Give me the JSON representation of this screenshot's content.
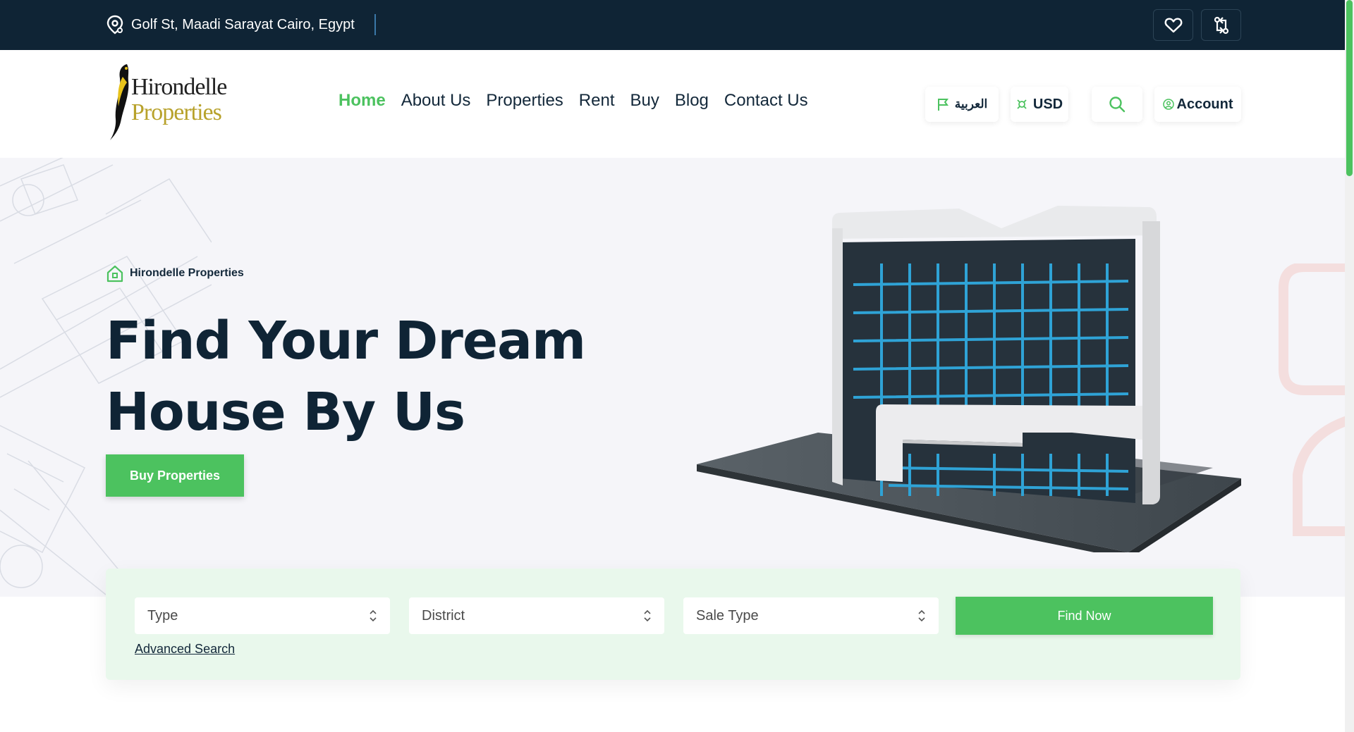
{
  "topbar": {
    "address": "Golf St, Maadi Sarayat Cairo, Egypt",
    "icons": [
      "location-pin-icon",
      "heart-icon",
      "compare-icon"
    ]
  },
  "header": {
    "logo_text_line1": "Hirondelle",
    "logo_text_line2": "Properties",
    "nav": [
      {
        "label": "Home",
        "active": true
      },
      {
        "label": "About Us",
        "active": false
      },
      {
        "label": "Properties",
        "active": false
      },
      {
        "label": "Rent",
        "active": false
      },
      {
        "label": "Buy",
        "active": false
      },
      {
        "label": "Blog",
        "active": false
      },
      {
        "label": "Contact Us",
        "active": false
      }
    ],
    "language_label": "العربية",
    "currency_label": "USD",
    "account_label": "Account"
  },
  "hero": {
    "breadcrumb": "Hirondelle Properties",
    "title_line1": "Find Your Dream",
    "title_line2": "House By Us",
    "cta_label": "Buy Properties"
  },
  "search": {
    "type_placeholder": "Type",
    "district_placeholder": "District",
    "sale_type_placeholder": "Sale Type",
    "find_label": "Find Now",
    "advanced_label": "Advanced Search"
  },
  "colors": {
    "accent": "#4cc25f",
    "dark": "#0f2435"
  }
}
